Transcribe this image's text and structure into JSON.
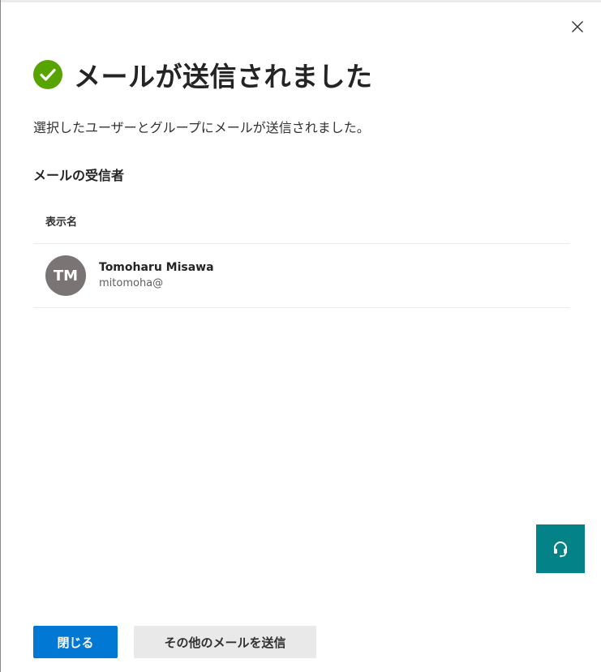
{
  "dialog": {
    "title": "メールが送信されました",
    "subtitle": "選択したユーザーとグループにメールが送信されました。",
    "status_icon": "check-circle-icon",
    "status_color": "#57a300",
    "close_icon": "close-icon"
  },
  "recipients": {
    "section_title": "メールの受信者",
    "column_header": "表示名",
    "items": [
      {
        "initials": "TM",
        "name": "Tomoharu Misawa",
        "email": "mitomoha@",
        "avatar_color": "#7a7574"
      }
    ]
  },
  "help": {
    "icon": "headset-icon",
    "color": "#038387"
  },
  "footer": {
    "close_label": "閉じる",
    "send_more_label": "その他のメールを送信",
    "primary_color": "#0078d4"
  }
}
